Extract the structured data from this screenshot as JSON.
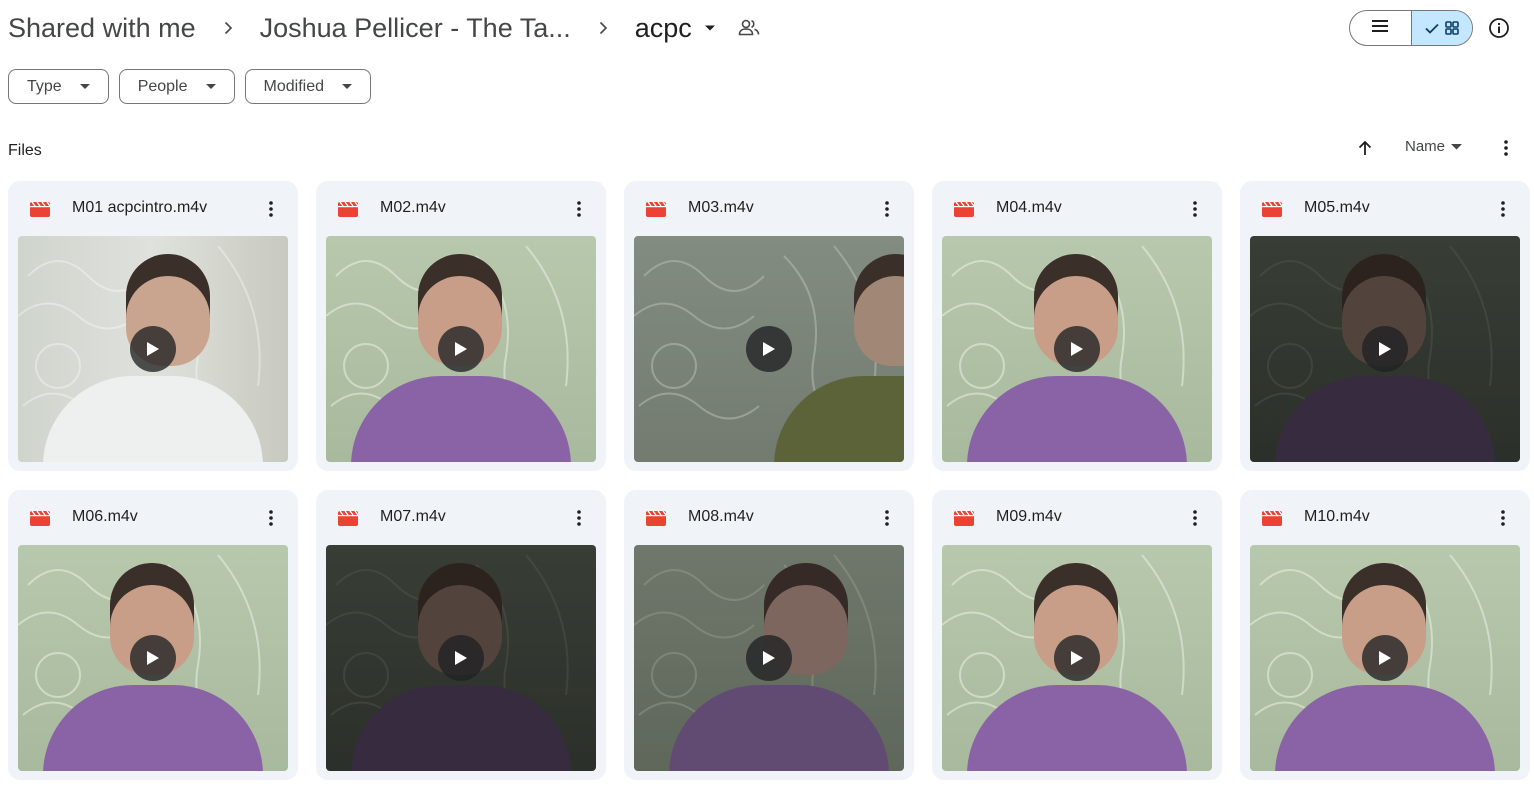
{
  "breadcrumb": {
    "items": [
      "Shared with me",
      "Joshua Pellicer - The Ta..."
    ],
    "current": "acpc"
  },
  "filters": [
    {
      "label": "Type"
    },
    {
      "label": "People"
    },
    {
      "label": "Modified"
    }
  ],
  "section_label": "Files",
  "sort": {
    "label": "Name",
    "direction": "ascending"
  },
  "view_mode": "grid",
  "colors": {
    "accent": "#c2e7ff",
    "card_bg": "#f0f4f9",
    "video_icon": "#ea4335"
  },
  "files": [
    {
      "name": "M01 acpcintro.m4v",
      "icon": "video-file-icon",
      "thumb": "white-shirt"
    },
    {
      "name": "M02.m4v",
      "icon": "video-file-icon",
      "thumb": "purple-green"
    },
    {
      "name": "M03.m4v",
      "icon": "video-file-icon",
      "thumb": "side-olive"
    },
    {
      "name": "M04.m4v",
      "icon": "video-file-icon",
      "thumb": "purple-green"
    },
    {
      "name": "M05.m4v",
      "icon": "video-file-icon",
      "thumb": "purple-dark"
    },
    {
      "name": "M06.m4v",
      "icon": "video-file-icon",
      "thumb": "purple-green"
    },
    {
      "name": "M07.m4v",
      "icon": "video-file-icon",
      "thumb": "purple-dark"
    },
    {
      "name": "M08.m4v",
      "icon": "video-file-icon",
      "thumb": "purple-dim"
    },
    {
      "name": "M09.m4v",
      "icon": "video-file-icon",
      "thumb": "purple-green"
    },
    {
      "name": "M10.m4v",
      "icon": "video-file-icon",
      "thumb": "purple-green"
    }
  ]
}
